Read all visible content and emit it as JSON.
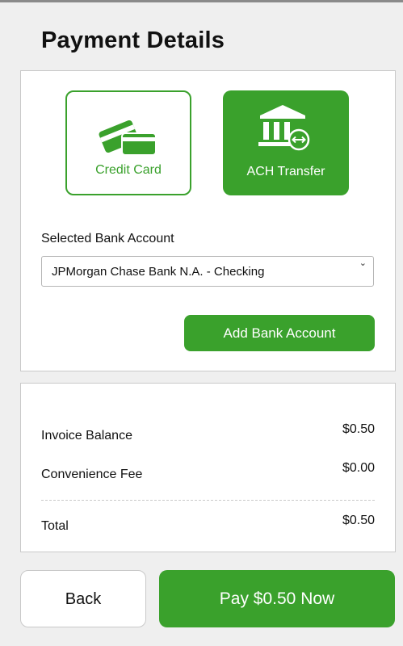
{
  "page": {
    "title": "Payment Details"
  },
  "payment_methods": [
    {
      "label": "Credit Card",
      "icon": "credit-card-icon",
      "selected": false
    },
    {
      "label": "ACH Transfer",
      "icon": "bank-transfer-icon",
      "selected": true
    }
  ],
  "bank_account": {
    "label": "Selected Bank Account",
    "selected_value": "JPMorgan Chase Bank N.A. - Checking",
    "add_button": "Add Bank Account"
  },
  "summary": {
    "invoice_balance_label": "Invoice Balance",
    "invoice_balance_value": "$0.50",
    "convenience_fee_label": "Convenience Fee",
    "convenience_fee_value": "$0.00",
    "total_label": "Total",
    "total_value": "$0.50"
  },
  "actions": {
    "back": "Back",
    "pay": "Pay $0.50 Now"
  },
  "colors": {
    "accent": "#3aa12c",
    "background": "#efefef",
    "card": "#ffffff"
  }
}
